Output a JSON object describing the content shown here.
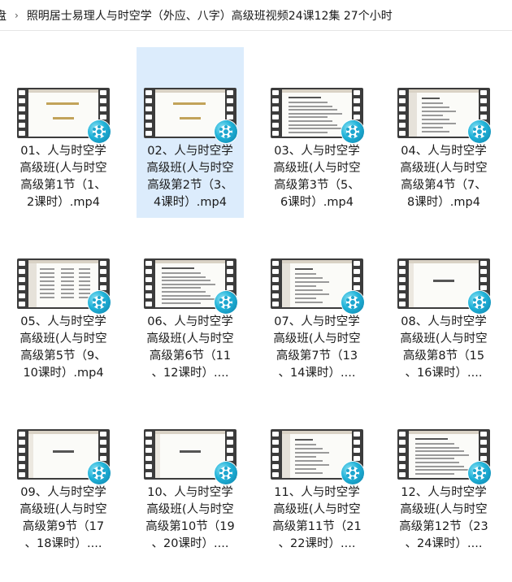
{
  "breadcrumb": {
    "root": "盘",
    "separator": "›",
    "current": "照明居士易理人与时空学（外应、八字）高级班视频24课12集 27个小时"
  },
  "files": [
    {
      "lines": [
        "01、人与时空学",
        "高级班(人与时空",
        "高级第1节（1、",
        "2课时）.mp4"
      ],
      "thumb": "title",
      "selected": false
    },
    {
      "lines": [
        "02、人与时空学",
        "高级班(人与时空",
        "高级第2节（3、",
        "4课时）.mp4"
      ],
      "thumb": "title",
      "selected": true
    },
    {
      "lines": [
        "03、人与时空学",
        "高级班(人与时空",
        "高级第3节（5、",
        "6课时）.mp4"
      ],
      "thumb": "text",
      "selected": false
    },
    {
      "lines": [
        "04、人与时空学",
        "高级班(人与时空",
        "高级第4节（7、",
        "8课时）.mp4"
      ],
      "thumb": "list",
      "selected": false
    },
    {
      "lines": [
        "05、人与时空学",
        "高级班(人与时空",
        "高级第5节（9、",
        "10课时）.mp4"
      ],
      "thumb": "columns",
      "selected": false
    },
    {
      "lines": [
        "06、人与时空学",
        "高级班(人与时空",
        "高级第6节（11",
        "、12课时）...."
      ],
      "thumb": "text",
      "selected": false
    },
    {
      "lines": [
        "07、人与时空学",
        "高级班(人与时空",
        "高级第7节（13",
        "、14课时）...."
      ],
      "thumb": "list",
      "selected": false
    },
    {
      "lines": [
        "08、人与时空学",
        "高级班(人与时空",
        "高级第8节（15",
        "、16课时）...."
      ],
      "thumb": "center",
      "selected": false
    },
    {
      "lines": [
        "09、人与时空学",
        "高级班(人与时空",
        "高级第9节（17",
        "、18课时）...."
      ],
      "thumb": "center",
      "selected": false
    },
    {
      "lines": [
        "10、人与时空学",
        "高级班(人与时空",
        "高级第10节（19",
        "、20课时）...."
      ],
      "thumb": "center",
      "selected": false
    },
    {
      "lines": [
        "11、人与时空学",
        "高级班(人与时空",
        "高级第11节（21",
        "、22课时）...."
      ],
      "thumb": "list",
      "selected": false
    },
    {
      "lines": [
        "12、人与时空学",
        "高级班(人与时空",
        "高级第12节（23",
        "、24课时）...."
      ],
      "thumb": "text",
      "selected": false
    }
  ]
}
